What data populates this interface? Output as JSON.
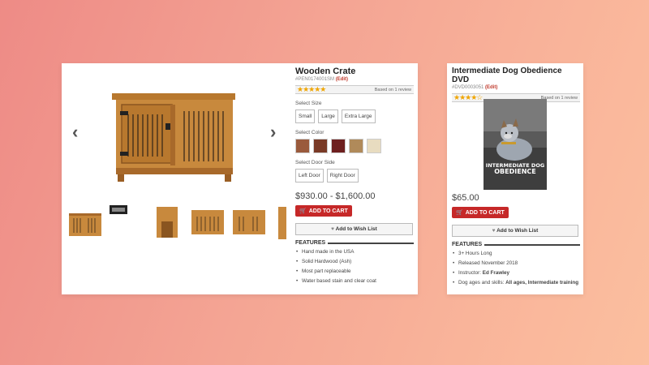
{
  "product1": {
    "title": "Wooden Crate",
    "sku": "#PEN0174001SM",
    "edit_label": "(Edit)",
    "stars": "★★★★★",
    "review_text": "Based on 1 review",
    "size_label": "Select Size",
    "sizes": [
      "Small",
      "Large",
      "Extra Large"
    ],
    "color_label": "Select Color",
    "colors": [
      "#9a5a3c",
      "#7a3a26",
      "#6e1f1f",
      "#b08a5a",
      "#e8dcc0"
    ],
    "door_label": "Select Door Side",
    "doors": [
      "Left Door",
      "Right Door"
    ],
    "price": "$930.00 - $1,600.00",
    "cart_label": "ADD TO CART",
    "wish_label": "Add to Wish List",
    "features_label": "FEATURES",
    "features": [
      "Hand made in the USA",
      "Solid Hardwood (Ash)",
      "Most part replaceable",
      "Water based stain and clear coat"
    ],
    "prev_arrow": "‹",
    "next_arrow": "›"
  },
  "product2": {
    "title": "Intermediate Dog Obedience DVD",
    "sku": "#DVD0003051",
    "edit_label": "(Edit)",
    "stars": "★★★★☆",
    "review_text": "Based on 1 review",
    "cover_title_1": "INTERMEDIATE DOG",
    "cover_title_2": "OBEDIENCE",
    "price": "$65.00",
    "cart_label": "ADD TO CART",
    "wish_label": "Add to Wish List",
    "features_label": "FEATURES",
    "feature_length": "3+ Hours Long",
    "feature_released": "Released November 2018",
    "feature_instructor_label": "Instructor:",
    "feature_instructor": "Ed Frawley",
    "feature_ages_label": "Dog ages and skills:",
    "feature_ages": "All ages, Intermediate training"
  }
}
